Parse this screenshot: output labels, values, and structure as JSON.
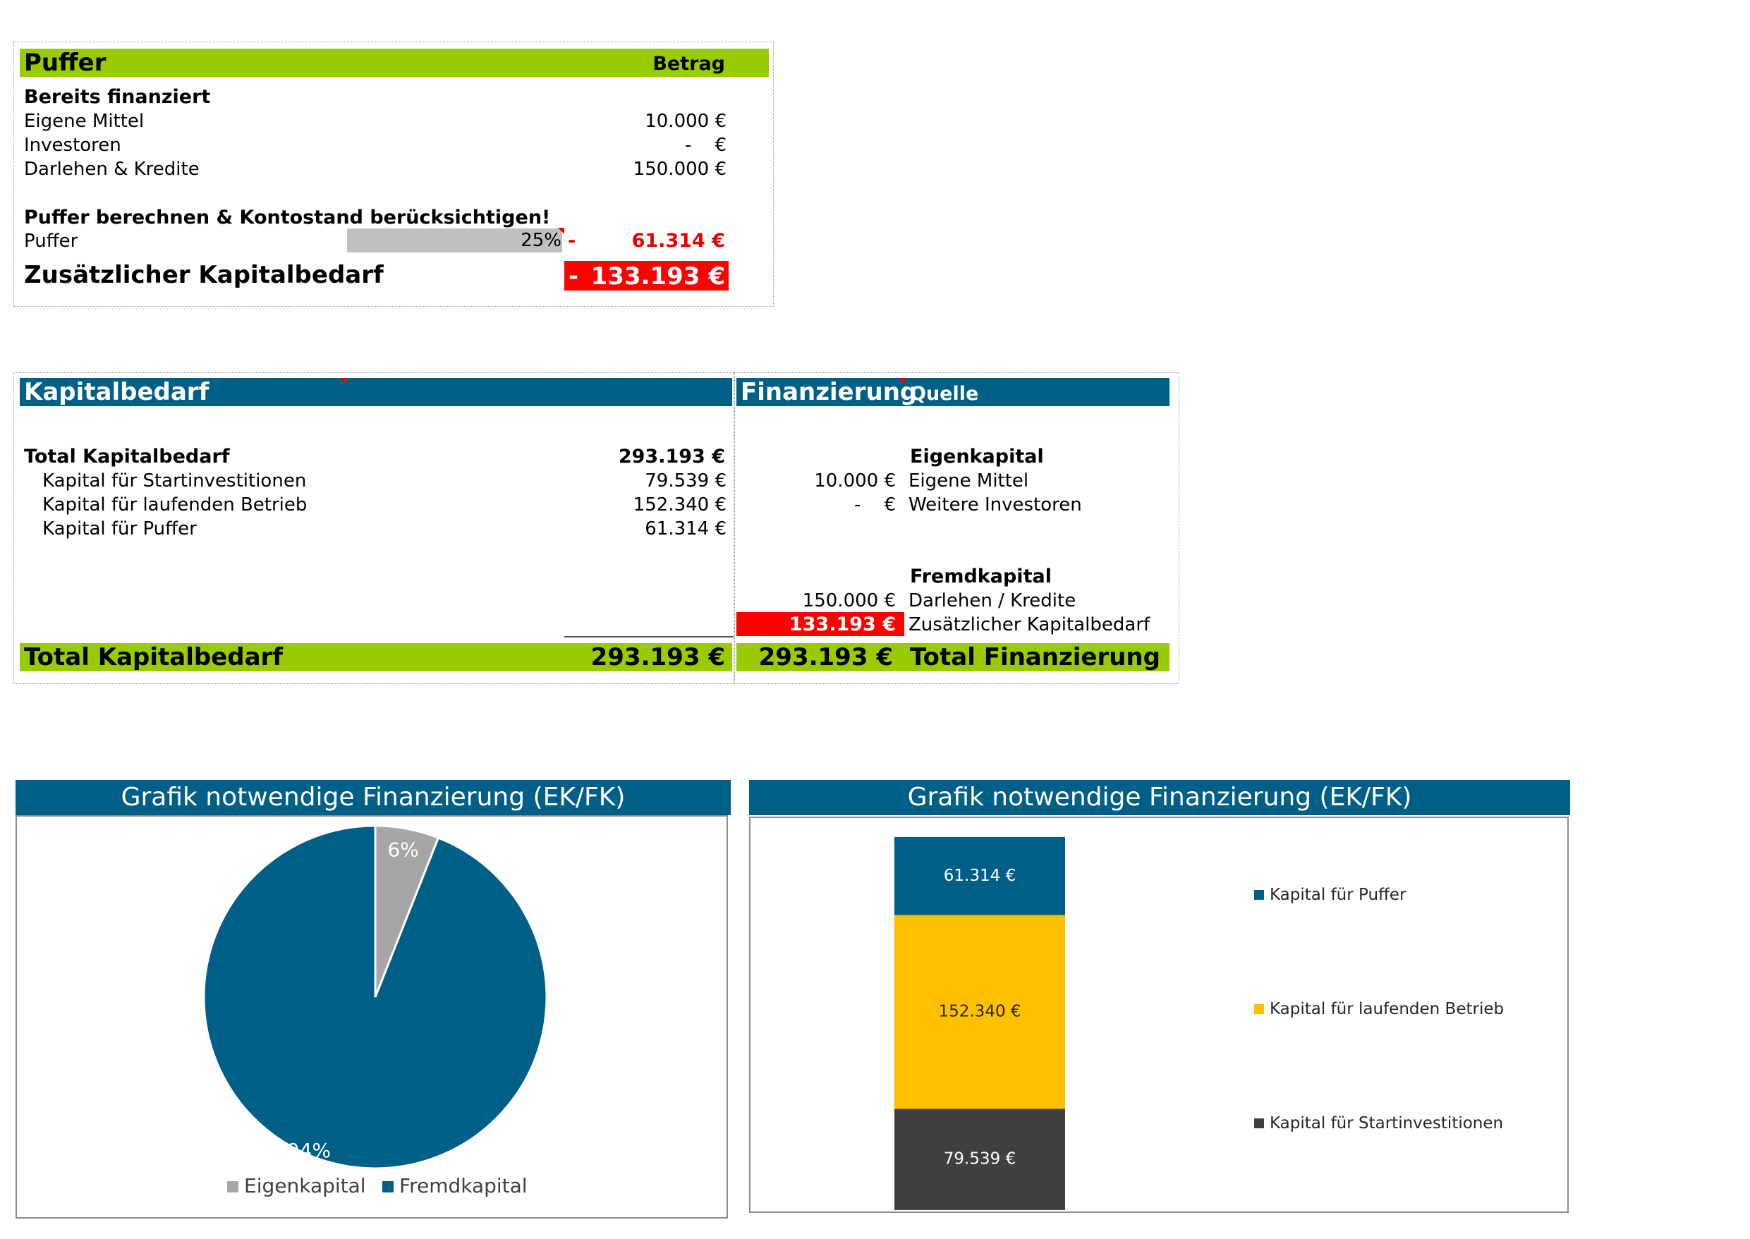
{
  "puffer_section": {
    "header": "Puffer",
    "header_amount": "Betrag",
    "already_financed_title": "Bereits finanziert",
    "rows": [
      {
        "label": "Eigene Mittel",
        "value": "10.000 €"
      },
      {
        "label": "Investoren",
        "value": "-    €"
      },
      {
        "label": "Darlehen & Kredite",
        "value": "150.000 €"
      }
    ],
    "calc_title": "Puffer berechnen & Kontostand berücksichtigen!",
    "puffer_label": "Puffer",
    "puffer_percent": "25%",
    "puffer_minus": "-",
    "puffer_value": "61.314 €",
    "zusatz_label": "Zusätzlicher Kapitalbedarf",
    "zusatz_minus": "-",
    "zusatz_value": "133.193 €"
  },
  "kapitalbedarf": {
    "header": "Kapitalbedarf",
    "total_label": "Total Kapitalbedarf",
    "total_value": "293.193 €",
    "rows": [
      {
        "label": "Kapital für Startinvestitionen",
        "value": "79.539 €"
      },
      {
        "label": "Kapital für laufenden Betrieb",
        "value": "152.340 €"
      },
      {
        "label": "Kapital für Puffer",
        "value": "61.314 €"
      }
    ],
    "footer_label": "Total Kapitalbedarf",
    "footer_value": "293.193 €"
  },
  "finanzierung": {
    "header": "Finanzierung",
    "header_source": "Quelle",
    "eigenkapital_title": "Eigenkapital",
    "eigen_rows": [
      {
        "value": "10.000 €",
        "label": "Eigene Mittel"
      },
      {
        "value": "-    €",
        "label": "Weitere Investoren"
      }
    ],
    "fremdkapital_title": "Fremdkapital",
    "darlehen_value": "150.000 €",
    "darlehen_label": "Darlehen / Kredite",
    "zusatz_value": "133.193 €",
    "zusatz_label": "Zusätzlicher Kapitalbedarf",
    "footer_value": "293.193 €",
    "footer_label": "Total Finanzierung"
  },
  "colors": {
    "green": "#99cc00",
    "blue": "#005f87",
    "red": "#ff0000",
    "gray": "#a6a6a6",
    "yellow": "#ffc000",
    "dark": "#404040"
  },
  "chart_data": [
    {
      "type": "pie",
      "title": "Grafik notwendige Finanzierung (EK/FK)",
      "slices": [
        {
          "name": "Eigenkapital",
          "value": 6,
          "label": "6%",
          "color": "#a6a6a6"
        },
        {
          "name": "Fremdkapital",
          "value": 94,
          "label": "94%",
          "color": "#005f87"
        }
      ],
      "legend": "bottom"
    },
    {
      "type": "bar",
      "stacked": true,
      "title": "Grafik notwendige Finanzierung (EK/FK)",
      "series": [
        {
          "name": "Kapital für Startinvestitionen",
          "value": 79539,
          "label": "79.539 €",
          "color": "#404040"
        },
        {
          "name": "Kapital für laufenden Betrieb",
          "value": 152340,
          "label": "152.340 €",
          "color": "#ffc000"
        },
        {
          "name": "Kapital für Puffer",
          "value": 61314,
          "label": "61.314 €",
          "color": "#005f87"
        }
      ],
      "legend": "right"
    }
  ]
}
